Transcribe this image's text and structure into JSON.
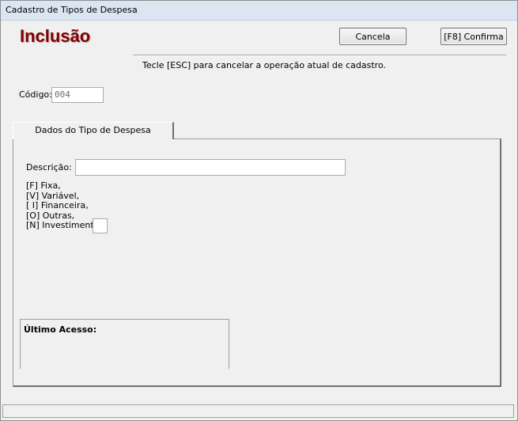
{
  "window": {
    "title": "Cadastro de Tipos de Despesa"
  },
  "header": {
    "mode": "Inclusão",
    "cancel_label": "Cancela",
    "confirm_label": "[F8]  Confirma",
    "hint": "Tecle [ESC] para cancelar a operação atual de cadastro."
  },
  "code": {
    "label": "Código:",
    "value": "004"
  },
  "tab": {
    "label": "Dados do Tipo de Despesa"
  },
  "form": {
    "description_label": "Descrição:",
    "description_value": "",
    "types": [
      "[F] Fixa,",
      "[V] Variável,",
      "[ I] Financeira,",
      "[O] Outras,",
      "[N] Investimento:"
    ],
    "type_value": ""
  },
  "last_access": {
    "label": "Último Acesso:"
  }
}
